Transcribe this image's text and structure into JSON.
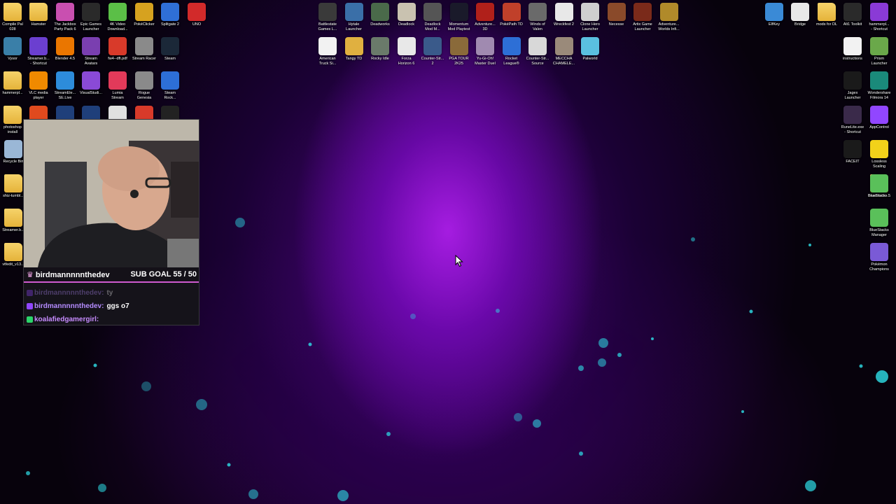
{
  "desktop": {
    "left_icons": [
      {
        "label": "Compile Pal\n028",
        "icon": "folder-icon",
        "color": "#e5b33a"
      },
      {
        "label": "Hamster",
        "icon": "folder-icon",
        "color": "#e5b33a"
      },
      {
        "label": "The Jackbox\nParty Pack 6",
        "icon": "jackbox-icon",
        "color": "#c94fb0"
      },
      {
        "label": "Epic Games\nLauncher",
        "icon": "epic-games-icon",
        "color": "#2a2a2a"
      },
      {
        "label": "4K Video\nDownload...",
        "icon": "video-download-icon",
        "color": "#5bbf47"
      },
      {
        "label": "PokéClicker",
        "icon": "pokeclicker-icon",
        "color": "#d6a21f"
      },
      {
        "label": "Splitgate 2",
        "icon": "splitgate-icon",
        "color": "#2f6fd6"
      },
      {
        "label": "UNO",
        "icon": "uno-icon",
        "color": "#d22a2a"
      },
      {
        "label": "Vysor",
        "icon": "vysor-icon",
        "color": "#3a7fa8"
      },
      {
        "label": "Streamer.b...\n- Shortcut",
        "icon": "streamerbot-icon",
        "color": "#6b3fd0"
      },
      {
        "label": "Blender 4.5",
        "icon": "blender-icon",
        "color": "#ea7600"
      },
      {
        "label": "Stream\nAvatars",
        "icon": "stream-avatars-icon",
        "color": "#7a3fb0"
      },
      {
        "label": "fw4--dft.pdf",
        "icon": "pdf-icon",
        "color": "#d83a2a"
      },
      {
        "label": "Stream Racer",
        "icon": "stream-racer-icon",
        "color": "#8a8a8a"
      },
      {
        "label": "Steam",
        "icon": "steam-icon",
        "color": "#1b2838"
      },
      {
        "label": "hammerpl...",
        "icon": "folder-icon",
        "color": "#e5b33a"
      },
      {
        "label": "VLC media\nplayer",
        "icon": "vlc-icon",
        "color": "#f08a00"
      },
      {
        "label": "StreamEle...\nSE.Live",
        "icon": "streamelements-icon",
        "color": "#2d8cdb"
      },
      {
        "label": "VisualStudi...",
        "icon": "visual-studio-icon",
        "color": "#8a4ad6"
      },
      {
        "label": "Lumia\nStream",
        "icon": "lumia-icon",
        "color": "#e23a5a"
      },
      {
        "label": "Rogue\nGenesia",
        "icon": "rogue-genesia-icon",
        "color": "#8a8a8a"
      },
      {
        "label": "Steam\nRock...",
        "icon": "rocket-league-icon",
        "color": "#2d6fd6"
      },
      {
        "label": "photoshop\ninstall",
        "icon": "folder-icon",
        "color": "#e5b33a"
      },
      {
        "label": "",
        "icon": "office-icon",
        "color": "#e04a1e"
      },
      {
        "label": "",
        "icon": "photoshop-icon",
        "color": "#1f3f7a"
      },
      {
        "label": "",
        "icon": "photoshop-icon",
        "color": "#1f3f7a"
      },
      {
        "label": "",
        "icon": "app-icon",
        "color": "#e0e0e0"
      },
      {
        "label": "",
        "icon": "pdf-icon",
        "color": "#d83a2a"
      },
      {
        "label": "",
        "icon": "logitech-icon",
        "color": "#222222"
      },
      {
        "label": "Recycle Bin",
        "icon": "recycle-bin-icon",
        "color": "#9ab7d6"
      },
      {
        "label": "shiz-tumbl...",
        "icon": "folder-icon",
        "color": "#e5b33a"
      },
      {
        "label": "Streamer.b...",
        "icon": "folder-icon",
        "color": "#e5b33a"
      },
      {
        "label": "vtfedit_v13...",
        "icon": "folder-icon",
        "color": "#e5b33a"
      }
    ],
    "middle_icons_row1": [
      {
        "label": "Battlestate\nGames L...",
        "icon": "battlestate-icon",
        "color": "#3a3a3a"
      },
      {
        "label": "Hytale\nLauncher",
        "icon": "hytale-icon",
        "color": "#3a6fa8"
      },
      {
        "label": "Deadworks",
        "icon": "deadworks-icon",
        "color": "#4a6a4a"
      },
      {
        "label": "Deadlock",
        "icon": "deadlock-icon",
        "color": "#c9c2b0"
      },
      {
        "label": "Deadlock\nMod M...",
        "icon": "deadlock-mod-icon",
        "color": "#555555"
      },
      {
        "label": "Momentum\nMod Playtest",
        "icon": "momentum-icon",
        "color": "#1a1a2a"
      },
      {
        "label": "Adventure...\n3D",
        "icon": "adventure-3d-icon",
        "color": "#b0201a"
      },
      {
        "label": "PokéPath TD",
        "icon": "pokepath-icon",
        "color": "#c0402a"
      },
      {
        "label": "Winds of\nValen",
        "icon": "winds-of-valen-icon",
        "color": "#6a6a6a"
      },
      {
        "label": "Wreckfest 2",
        "icon": "wreckfest-icon",
        "color": "#e8e8e8"
      },
      {
        "label": "Clone Hero\nLauncher",
        "icon": "clone-hero-icon",
        "color": "#cfcfcf"
      },
      {
        "label": "Necesse",
        "icon": "necesse-icon",
        "color": "#8a4a2a"
      },
      {
        "label": "Artix Game\nLauncher",
        "icon": "artix-icon",
        "color": "#7a2a1a"
      },
      {
        "label": "Adventure...\nWorlds Infi...",
        "icon": "adventure-worlds-icon",
        "color": "#b08a2a"
      }
    ],
    "middle_icons_row2": [
      {
        "label": "American\nTruck Si...",
        "icon": "document-icon",
        "color": "#f2f2f2"
      },
      {
        "label": "Tangy TD",
        "icon": "tangy-td-icon",
        "color": "#e0b040"
      },
      {
        "label": "Rocky Idle",
        "icon": "rocky-idle-icon",
        "color": "#6a7a6a"
      },
      {
        "label": "Forza\nHorizon 6",
        "icon": "forza-icon",
        "color": "#e8e8e8"
      },
      {
        "label": "Counter-Str...\n2",
        "icon": "counter-strike-icon",
        "color": "#3a5a8a"
      },
      {
        "label": "PGA TOUR\n2K25",
        "icon": "pga-tour-icon",
        "color": "#8a6a3a"
      },
      {
        "label": "Yu-Gi-Oh!\nMaster Duel",
        "icon": "yugioh-icon",
        "color": "#a08ab0"
      },
      {
        "label": "Rocket\nLeague®",
        "icon": "rocket-league-icon",
        "color": "#2d6fd6"
      },
      {
        "label": "Counter-Str...\nSource",
        "icon": "counter-strike-source-icon",
        "color": "#d8d8d8"
      },
      {
        "label": "MECCHA\nCHAMELE...",
        "icon": "meccha-icon",
        "color": "#9a8a7a"
      },
      {
        "label": "Palworld",
        "icon": "palworld-icon",
        "color": "#5ac0e0"
      }
    ],
    "right_icons": [
      {
        "label": "ElfKey",
        "icon": "elfkey-icon",
        "color": "#3a8ad6"
      },
      {
        "label": "Bridge",
        "icon": "bridge-icon",
        "color": "#e8e8e8"
      },
      {
        "label": "mods for DL",
        "icon": "folder-icon",
        "color": "#e5b33a"
      },
      {
        "label": "Alt1 Toolkit",
        "icon": "alt1-icon",
        "color": "#2a2a2a"
      },
      {
        "label": "hammerpl...\n- Shortcut",
        "icon": "hammer-icon",
        "color": "#8a3ad6"
      },
      {
        "label": "instructions",
        "icon": "chrome-icon",
        "color": "#f2f2f2"
      },
      {
        "label": "Prism\nLauncher",
        "icon": "prism-icon",
        "color": "#6aa84a"
      },
      {
        "label": "Jagex\nLauncher",
        "icon": "jagex-icon",
        "color": "#1a1a1a"
      },
      {
        "label": "Wondershare\nFilmora 14",
        "icon": "filmora-icon",
        "color": "#1a8a7a"
      },
      {
        "label": "RuneLite.exe\n- Shortcut",
        "icon": "runelite-icon",
        "color": "#3a2a4a"
      },
      {
        "label": "AppControl",
        "icon": "twitch-icon",
        "color": "#9146ff"
      },
      {
        "label": "FACEIT",
        "icon": "faceit-icon",
        "color": "#1a1a1a"
      },
      {
        "label": "Lossless\nScaling",
        "icon": "lossless-scaling-icon",
        "color": "#f2d21a"
      },
      {
        "label": "veadotube-...",
        "icon": "folder-icon",
        "color": "#e5b33a"
      },
      {
        "label": "BlueStacks 5",
        "icon": "bluestacks-icon",
        "color": "#5ac05a"
      },
      {
        "label": "BlueStacks\nManager",
        "icon": "bluestacks-manager-icon",
        "color": "#5ac05a"
      },
      {
        "label": "Pokémon\nChampions",
        "icon": "pokemon-champions-icon",
        "color": "#7a5ad6"
      }
    ]
  },
  "stream_overlay": {
    "username": "birdmannnnnthedev",
    "sub_goal": "SUB GOAL 55 / 50",
    "accent": "#d05ad0",
    "chat": [
      {
        "user": "birdmannnnnthedev:",
        "message": "ty",
        "user_color": "#b58cff",
        "faded": true
      },
      {
        "user": "birdmannnnnthedev:",
        "message": "ggs o7",
        "user_color": "#b58cff",
        "faded": false
      },
      {
        "user": "koalafiedgamergirl:",
        "message": "",
        "user_color": "#c78cff",
        "faded": false
      }
    ]
  }
}
